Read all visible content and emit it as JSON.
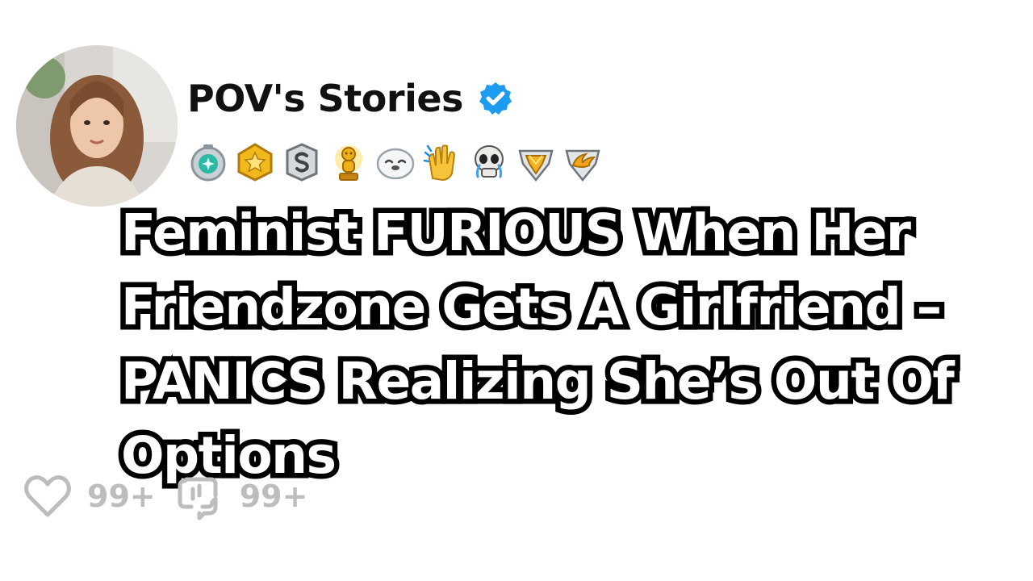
{
  "post": {
    "author": {
      "name": "POV's Stories",
      "verified": true,
      "avatar": "avatar-photo",
      "verified_color": "#1d9bf0"
    },
    "awards": [
      "helpful-award-icon",
      "star-award-icon",
      "silver-award-icon",
      "gold-trophy-award-icon",
      "seal-award-icon",
      "clapping-hands-award-icon",
      "skull-crying-award-icon",
      "gold-diamond-award-icon",
      "wings-award-icon"
    ],
    "title_lines": [
      "Feminist FURIOUS When Her",
      "Friendzone Gets A Girlfriend –",
      "PANICS Realizing She’s Out Of",
      "Options"
    ],
    "stats": {
      "likes_icon": "heart-icon",
      "likes": "99+",
      "comments_icon": "comment-icon",
      "comments": "99+",
      "stat_color": "#bdbdbd"
    }
  }
}
